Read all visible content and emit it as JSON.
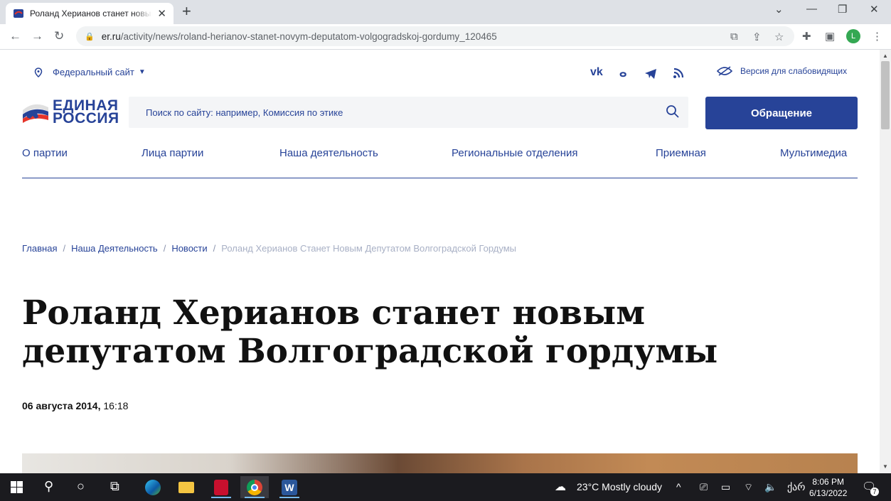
{
  "browser": {
    "tab_title": "Роланд Херианов станет новым депутатом Волгоградской гордумы",
    "new_tab": "+",
    "url_host": "er.ru",
    "url_path": "/activity/news/roland-herianov-stanet-novym-deputatom-volgogradskoj-gordumy_120465",
    "profile_initial": "L"
  },
  "site": {
    "region_label": "Федеральный сайт",
    "vision_label": "Версия для слабовидящих",
    "social": [
      "vk",
      "ok",
      "telegram",
      "rss"
    ],
    "logo_line1": "ЕДИНАЯ",
    "logo_line2": "РОССИЯ",
    "search_placeholder": "Поиск по сайту: например, Комиссия по этике",
    "appeal_button": "Обращение",
    "menu": [
      "О партии",
      "Лица партии",
      "Наша деятельность",
      "Региональные отделения",
      "Приемная",
      "Мультимедиа"
    ],
    "breadcrumbs": [
      "Главная",
      "Наша Деятельность",
      "Новости"
    ],
    "breadcrumb_current": "Роланд Херианов Станет Новым Депутатом Волгоградской Гордумы",
    "headline": "Роланд Херианов станет новым депутатом Волгоградской гордумы",
    "date": "06 августа 2014,",
    "time": "16:18"
  },
  "colors": {
    "brand": "#274398",
    "taskbar": "#1b1b1f"
  },
  "taskbar": {
    "weather": "23°C  Mostly cloudy",
    "lang": "ქარ",
    "time": "8:06 PM",
    "date": "6/13/2022",
    "notifications": "7"
  }
}
